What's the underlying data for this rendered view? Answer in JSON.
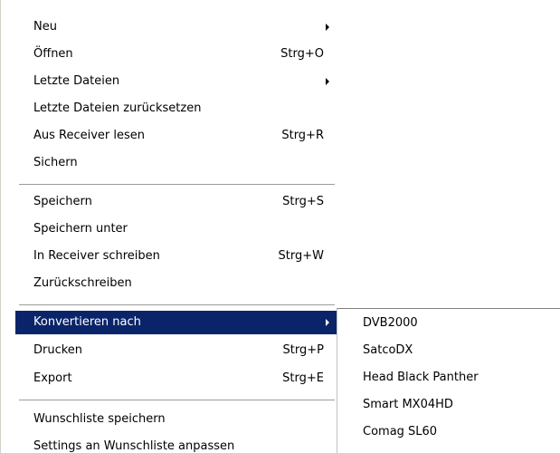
{
  "menu": {
    "items": [
      {
        "label": "Neu",
        "shortcut": "",
        "submenu": true
      },
      {
        "label": "Öffnen",
        "shortcut": "Strg+O",
        "submenu": false
      },
      {
        "label": "Letzte Dateien",
        "shortcut": "",
        "submenu": true
      },
      {
        "label": "Letzte Dateien zurücksetzen",
        "shortcut": "",
        "submenu": false
      },
      {
        "label": "Aus Receiver lesen",
        "shortcut": "Strg+R",
        "submenu": false
      },
      {
        "label": "Sichern",
        "shortcut": "",
        "submenu": false
      },
      {
        "label": "Speichern",
        "shortcut": "Strg+S",
        "submenu": false
      },
      {
        "label": "Speichern unter",
        "shortcut": "",
        "submenu": false
      },
      {
        "label": "In Receiver schreiben",
        "shortcut": "Strg+W",
        "submenu": false
      },
      {
        "label": "Zurückschreiben",
        "shortcut": "",
        "submenu": false
      },
      {
        "label": "Konvertieren nach",
        "shortcut": "",
        "submenu": true,
        "highlighted": true
      },
      {
        "label": "Drucken",
        "shortcut": "Strg+P",
        "submenu": false
      },
      {
        "label": "Export",
        "shortcut": "Strg+E",
        "submenu": false
      },
      {
        "label": "Wunschliste speichern",
        "shortcut": "",
        "submenu": false
      },
      {
        "label": "Settings an Wunschliste anpassen",
        "shortcut": "",
        "submenu": false
      }
    ]
  },
  "submenu": {
    "items": [
      {
        "label": "DVB2000"
      },
      {
        "label": "SatcoDX"
      },
      {
        "label": "Head Black Panther"
      },
      {
        "label": "Smart MX04HD"
      },
      {
        "label": "Comag SL60"
      }
    ]
  },
  "colors": {
    "highlight_bg": "#0a246a",
    "highlight_text": "#ffffff",
    "separator": "#9c9c9c"
  }
}
